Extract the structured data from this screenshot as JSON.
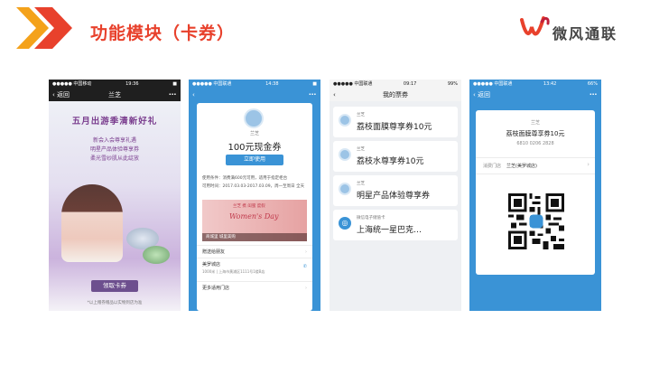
{
  "slide": {
    "title": "功能模块（卡券）",
    "logo_text": "微风通联",
    "accent_color": "#e8412c",
    "brand_color": "#e8412c"
  },
  "phone1": {
    "status_left": "●●●●● 中国移动",
    "status_time": "19:36",
    "status_right": "■",
    "back_label": "返回",
    "nav_title": "兰芝",
    "more_icon": "⋯",
    "headline": "五月出游季清新好礼",
    "sub1": "新会入会尊享礼遇",
    "sub2": "明星产品体验尊享券",
    "sub3": "柔光雪纱肌从此绽放",
    "claim_button": "领取卡券",
    "footnote": "*以上赠券赠品以实物到店为准"
  },
  "phone2": {
    "status_left": "●●●●● 中国联通",
    "status_time": "14:38",
    "status_right": "■",
    "more_icon": "⋯",
    "merchant": "兰芝",
    "coupon_title": "100元现金券",
    "use_button": "立即使用",
    "condition_label": "使用条件：",
    "condition_value": "消费满600元可用，适用于指定柜台",
    "validity_label": "可用时间：",
    "validity_value": "2017.03.03-2017.03.09，周一至周日 全天",
    "promo_small": "兰芝 携 闺蜜 度假",
    "promo_big": "Women's Day",
    "promo_bar": "商城里 城里美购",
    "row_gift": "赠送给朋友",
    "store_name": "美罗城店",
    "store_addr": "1000米 | 上海市黄浦区1111号1楼B店",
    "row_more_stores": "更多适用门店"
  },
  "phone3": {
    "status_left": "●●●●● 中国联通",
    "status_time": "09:17",
    "status_right": "99%",
    "nav_title": "我的票券",
    "tickets": [
      {
        "merchant": "兰芝",
        "title": "荔枝面膜尊享券10元"
      },
      {
        "merchant": "兰芝",
        "title": "荔枝水尊享券10元"
      },
      {
        "merchant": "兰芝",
        "title": "明星产品体验尊享券"
      },
      {
        "merchant": "微信电子储值卡",
        "title": "上海统一星巴克…"
      }
    ]
  },
  "phone4": {
    "status_left": "●●●●● 中国联通",
    "status_time": "13:42",
    "status_right": "66%",
    "back_label": "返回",
    "more_icon": "⋯",
    "merchant": "兰芝",
    "coupon_title": "荔枝面膜尊享券10元",
    "code": "6810 0206 2828",
    "store_label": "消费门店",
    "store_value": "兰芝(美罗城店)"
  }
}
